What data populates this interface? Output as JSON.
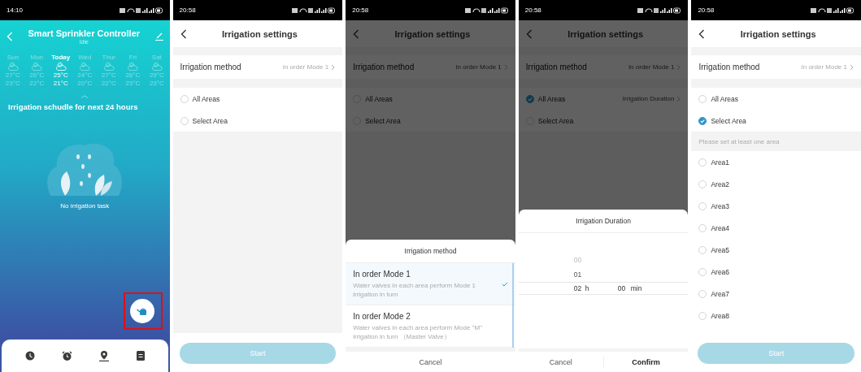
{
  "screens": [
    {
      "kind": "home",
      "status_time": "14:10",
      "title": "Smart Sprinkler Controller",
      "subtitle": "Idle",
      "forecast": [
        {
          "day": "Sun",
          "high": "27°C",
          "low": "23°C",
          "selected": false
        },
        {
          "day": "Mon",
          "high": "26°C",
          "low": "22°C",
          "selected": false
        },
        {
          "day": "Today",
          "high": "25°C",
          "low": "21°C",
          "selected": true
        },
        {
          "day": "Wed",
          "high": "24°C",
          "low": "20°C",
          "selected": false
        },
        {
          "day": "Thur",
          "high": "27°C",
          "low": "22°C",
          "selected": false
        },
        {
          "day": "Fri",
          "high": "28°C",
          "low": "23°C",
          "selected": false
        },
        {
          "day": "Sat",
          "high": "29°C",
          "low": "23°C",
          "selected": false
        }
      ],
      "schedule_heading": "Irrigation schudle for next 24 hours",
      "empty_text": "No irrigation task",
      "fab_highlighted": true
    },
    {
      "kind": "settings",
      "status_time": "20:58",
      "title": "Irrigation settings",
      "method_label": "Irrigation method",
      "method_value": "In order Mode 1",
      "options": [
        {
          "label": "All Areas",
          "selected": false
        },
        {
          "label": "Select Area",
          "selected": false
        }
      ],
      "start_button": "Start"
    },
    {
      "kind": "settings",
      "status_time": "20:58",
      "title": "Irrigation settings",
      "method_label": "Irrigation method",
      "method_value": "In order Mode 1",
      "options": [
        {
          "label": "All Areas",
          "selected": false
        },
        {
          "label": "Select Area",
          "selected": false
        }
      ],
      "sheet": {
        "kind": "method",
        "title": "Irrigation method",
        "options": [
          {
            "name": "In order Mode 1",
            "description": "Water valves in each area perform Mode 1 irrigation in turn",
            "selected": true
          },
          {
            "name": "In order Mode 2",
            "description": "Water valves in each area perform Mode \"M\" irrigation in turn （Master Valve）",
            "selected": false
          }
        ],
        "cancel": "Cancel"
      }
    },
    {
      "kind": "settings",
      "status_time": "20:58",
      "title": "Irrigation settings",
      "method_label": "Irrigation method",
      "method_value": "In order Mode 1",
      "options": [
        {
          "label": "All Areas",
          "selected": true,
          "value": "Irrigation  Duration"
        },
        {
          "label": "Select Area",
          "selected": false
        }
      ],
      "sheet": {
        "kind": "duration",
        "title": "Irrigation  Duration",
        "hours": [
          {
            "value": "00",
            "selected": false
          },
          {
            "value": "01",
            "selected": false
          },
          {
            "value": "02",
            "selected": true
          }
        ],
        "hour_unit": "h",
        "minutes": [
          {
            "value": "00",
            "selected": true
          }
        ],
        "minute_unit": "min",
        "cancel": "Cancel",
        "confirm": "Confirm"
      }
    },
    {
      "kind": "settings",
      "status_time": "20:58",
      "title": "Irrigation settings",
      "method_label": "Irrigation method",
      "method_value": "In order Mode 1",
      "options": [
        {
          "label": "All Areas",
          "selected": false
        },
        {
          "label": "Select Area",
          "selected": true
        }
      ],
      "notice": "Please set at least one area",
      "areas": [
        {
          "label": "Area1",
          "selected": false
        },
        {
          "label": "Area2",
          "selected": false
        },
        {
          "label": "Area3",
          "selected": false
        },
        {
          "label": "Area4",
          "selected": false
        },
        {
          "label": "Area5",
          "selected": false
        },
        {
          "label": "Area6",
          "selected": false
        },
        {
          "label": "Area7",
          "selected": false
        },
        {
          "label": "Area8",
          "selected": false
        }
      ],
      "start_button": "Start"
    }
  ]
}
